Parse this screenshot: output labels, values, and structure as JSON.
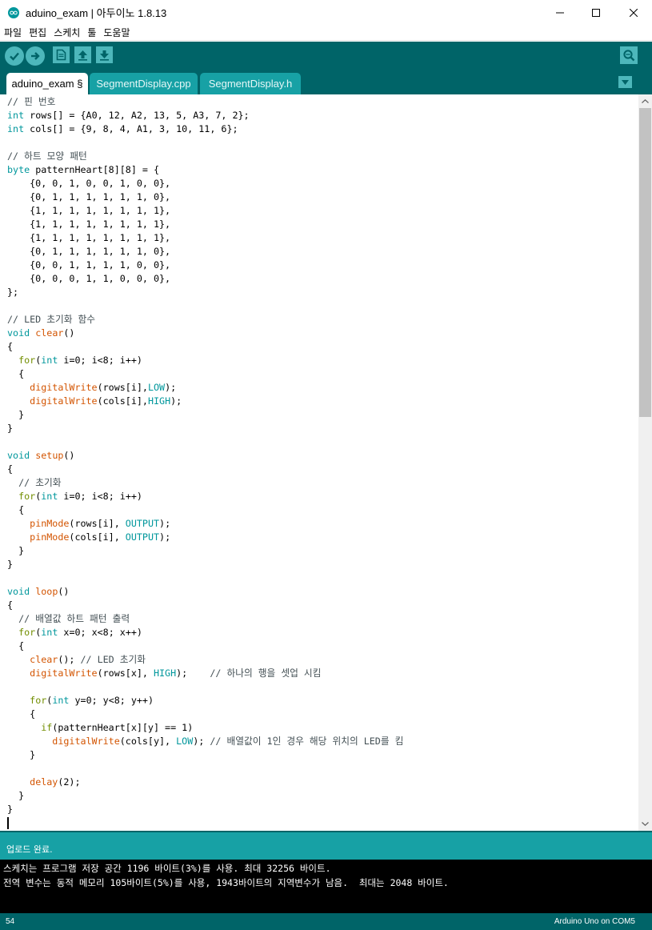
{
  "window": {
    "title": "aduino_exam | 아두이노 1.8.13",
    "icon": "arduino-icon"
  },
  "menu": [
    "파일",
    "편집",
    "스케치",
    "툴",
    "도움말"
  ],
  "toolbar": {
    "buttons": [
      "verify-icon",
      "upload-icon",
      "new-icon",
      "open-icon",
      "save-icon"
    ],
    "serial_monitor": "serial-monitor-icon"
  },
  "tabs": [
    {
      "label": "aduino_exam §"
    },
    {
      "label": "SegmentDisplay.cpp"
    },
    {
      "label": "SegmentDisplay.h"
    }
  ],
  "code_lines": [
    [
      [
        "cmt",
        "// 핀 번호"
      ]
    ],
    [
      [
        "kw-type",
        "int"
      ],
      [
        "plain",
        " rows[] = {A0, 12, A2, 13, 5, A3, 7, 2};"
      ]
    ],
    [
      [
        "kw-type",
        "int"
      ],
      [
        "plain",
        " cols[] = {9, 8, 4, A1, 3, 10, 11, 6};"
      ]
    ],
    [
      [
        "plain",
        ""
      ]
    ],
    [
      [
        "cmt",
        "// 하트 모양 패턴"
      ]
    ],
    [
      [
        "kw-type",
        "byte"
      ],
      [
        "plain",
        " patternHeart[8][8] = {"
      ]
    ],
    [
      [
        "plain",
        "    {0, 0, 1, 0, 0, 1, 0, 0},"
      ]
    ],
    [
      [
        "plain",
        "    {0, 1, 1, 1, 1, 1, 1, 0},"
      ]
    ],
    [
      [
        "plain",
        "    {1, 1, 1, 1, 1, 1, 1, 1},"
      ]
    ],
    [
      [
        "plain",
        "    {1, 1, 1, 1, 1, 1, 1, 1},"
      ]
    ],
    [
      [
        "plain",
        "    {1, 1, 1, 1, 1, 1, 1, 1},"
      ]
    ],
    [
      [
        "plain",
        "    {0, 1, 1, 1, 1, 1, 1, 0},"
      ]
    ],
    [
      [
        "plain",
        "    {0, 0, 1, 1, 1, 1, 0, 0},"
      ]
    ],
    [
      [
        "plain",
        "    {0, 0, 0, 1, 1, 0, 0, 0},"
      ]
    ],
    [
      [
        "plain",
        "};"
      ]
    ],
    [
      [
        "plain",
        ""
      ]
    ],
    [
      [
        "cmt",
        "// LED 초기화 함수"
      ]
    ],
    [
      [
        "kw-type",
        "void"
      ],
      [
        "plain",
        " "
      ],
      [
        "fn",
        "clear"
      ],
      [
        "plain",
        "()"
      ]
    ],
    [
      [
        "plain",
        "{"
      ]
    ],
    [
      [
        "plain",
        "  "
      ],
      [
        "kw-ctrl",
        "for"
      ],
      [
        "plain",
        "("
      ],
      [
        "kw-type",
        "int"
      ],
      [
        "plain",
        " i=0; i<8; i++)"
      ]
    ],
    [
      [
        "plain",
        "  {"
      ]
    ],
    [
      [
        "plain",
        "    "
      ],
      [
        "fn",
        "digitalWrite"
      ],
      [
        "plain",
        "(rows[i],"
      ],
      [
        "const",
        "LOW"
      ],
      [
        "plain",
        ");"
      ]
    ],
    [
      [
        "plain",
        "    "
      ],
      [
        "fn",
        "digitalWrite"
      ],
      [
        "plain",
        "(cols[i],"
      ],
      [
        "const",
        "HIGH"
      ],
      [
        "plain",
        ");"
      ]
    ],
    [
      [
        "plain",
        "  }"
      ]
    ],
    [
      [
        "plain",
        "}"
      ]
    ],
    [
      [
        "plain",
        ""
      ]
    ],
    [
      [
        "kw-type",
        "void"
      ],
      [
        "plain",
        " "
      ],
      [
        "fn",
        "setup"
      ],
      [
        "plain",
        "()"
      ]
    ],
    [
      [
        "plain",
        "{"
      ]
    ],
    [
      [
        "plain",
        "  "
      ],
      [
        "cmt",
        "// 초기화"
      ]
    ],
    [
      [
        "plain",
        "  "
      ],
      [
        "kw-ctrl",
        "for"
      ],
      [
        "plain",
        "("
      ],
      [
        "kw-type",
        "int"
      ],
      [
        "plain",
        " i=0; i<8; i++)"
      ]
    ],
    [
      [
        "plain",
        "  {"
      ]
    ],
    [
      [
        "plain",
        "    "
      ],
      [
        "fn",
        "pinMode"
      ],
      [
        "plain",
        "(rows[i], "
      ],
      [
        "const",
        "OUTPUT"
      ],
      [
        "plain",
        ");"
      ]
    ],
    [
      [
        "plain",
        "    "
      ],
      [
        "fn",
        "pinMode"
      ],
      [
        "plain",
        "(cols[i], "
      ],
      [
        "const",
        "OUTPUT"
      ],
      [
        "plain",
        ");"
      ]
    ],
    [
      [
        "plain",
        "  }"
      ]
    ],
    [
      [
        "plain",
        "}"
      ]
    ],
    [
      [
        "plain",
        ""
      ]
    ],
    [
      [
        "kw-type",
        "void"
      ],
      [
        "plain",
        " "
      ],
      [
        "fn",
        "loop"
      ],
      [
        "plain",
        "()"
      ]
    ],
    [
      [
        "plain",
        "{"
      ]
    ],
    [
      [
        "plain",
        "  "
      ],
      [
        "cmt",
        "// 배열값 하트 패턴 출력"
      ]
    ],
    [
      [
        "plain",
        "  "
      ],
      [
        "kw-ctrl",
        "for"
      ],
      [
        "plain",
        "("
      ],
      [
        "kw-type",
        "int"
      ],
      [
        "plain",
        " x=0; x<8; x++)"
      ]
    ],
    [
      [
        "plain",
        "  {"
      ]
    ],
    [
      [
        "plain",
        "    "
      ],
      [
        "fn",
        "clear"
      ],
      [
        "plain",
        "(); "
      ],
      [
        "cmt",
        "// LED 초기화"
      ]
    ],
    [
      [
        "plain",
        "    "
      ],
      [
        "fn",
        "digitalWrite"
      ],
      [
        "plain",
        "(rows[x], "
      ],
      [
        "const",
        "HIGH"
      ],
      [
        "plain",
        ");    "
      ],
      [
        "cmt",
        "// 하나의 행을 셋업 시킴"
      ]
    ],
    [
      [
        "plain",
        ""
      ]
    ],
    [
      [
        "plain",
        "    "
      ],
      [
        "kw-ctrl",
        "for"
      ],
      [
        "plain",
        "("
      ],
      [
        "kw-type",
        "int"
      ],
      [
        "plain",
        " y=0; y<8; y++)"
      ]
    ],
    [
      [
        "plain",
        "    {"
      ]
    ],
    [
      [
        "plain",
        "      "
      ],
      [
        "kw-ctrl",
        "if"
      ],
      [
        "plain",
        "(patternHeart[x][y] == 1)"
      ]
    ],
    [
      [
        "plain",
        "        "
      ],
      [
        "fn",
        "digitalWrite"
      ],
      [
        "plain",
        "(cols[y], "
      ],
      [
        "const",
        "LOW"
      ],
      [
        "plain",
        "); "
      ],
      [
        "cmt",
        "// 배열값이 1인 경우 해당 위치의 LED를 킴"
      ]
    ],
    [
      [
        "plain",
        "    }"
      ]
    ],
    [
      [
        "plain",
        ""
      ]
    ],
    [
      [
        "plain",
        "    "
      ],
      [
        "fn",
        "delay"
      ],
      [
        "plain",
        "(2);"
      ]
    ],
    [
      [
        "plain",
        "  }"
      ]
    ],
    [
      [
        "plain",
        "}"
      ]
    ],
    [
      [
        "cursor",
        ""
      ]
    ]
  ],
  "status": {
    "message": "업로드 완료."
  },
  "console": [
    "스케치는 프로그램 저장 공간 1196 바이트(3%)를 사용. 최대 32256 바이트.",
    "전역 변수는 동적 메모리 105바이트(5%)를 사용, 1943바이트의 지역변수가 남음.  최대는 2048 바이트."
  ],
  "footer": {
    "line_number": "54",
    "board": "Arduino Uno on COM5"
  },
  "colors": {
    "teal_dark": "#006468",
    "teal_mid": "#17a1a5",
    "teal_button": "#4db7bb",
    "keyword": "#00979c",
    "control": "#728e00",
    "function": "#d35400",
    "comment": "#434f54"
  }
}
